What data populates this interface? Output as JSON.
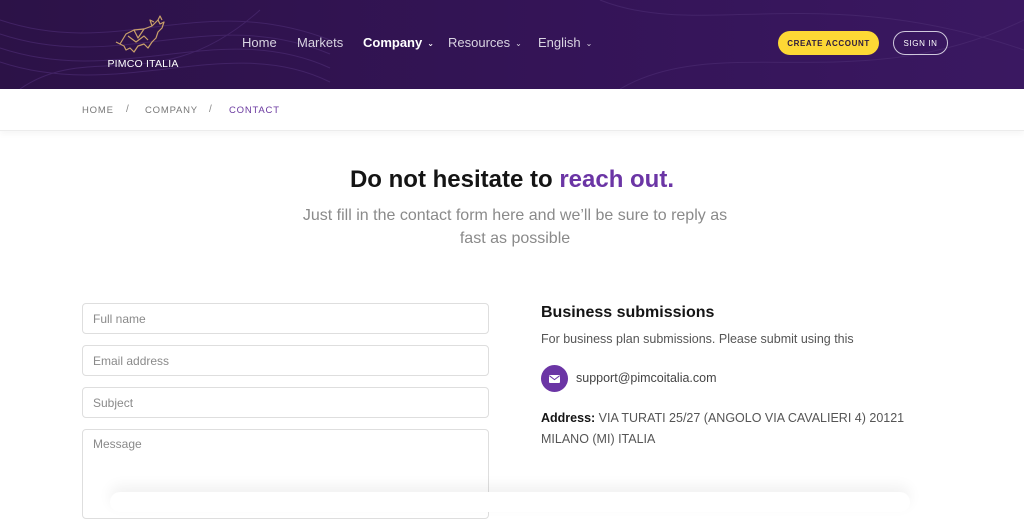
{
  "brand": {
    "name": "PIMCO ITALIA"
  },
  "nav": {
    "items": [
      {
        "label": "Home",
        "dropdown": false,
        "active": false
      },
      {
        "label": "Markets",
        "dropdown": false,
        "active": false
      },
      {
        "label": "Company",
        "dropdown": true,
        "active": true
      },
      {
        "label": "Resources",
        "dropdown": true,
        "active": false
      },
      {
        "label": "English",
        "dropdown": true,
        "active": false
      }
    ],
    "create_account": "CREATE ACCOUNT",
    "sign_in": "SIGN IN"
  },
  "breadcrumb": {
    "home": "HOME",
    "company": "COMPANY",
    "current": "CONTACT",
    "separator": "/"
  },
  "hero": {
    "title_plain": "Do not hesitate to ",
    "title_accent": "reach out.",
    "subtitle": "Just fill in the contact form here and we’ll be sure to reply as fast as possible"
  },
  "form": {
    "full_name_placeholder": "Full name",
    "email_placeholder": "Email address",
    "subject_placeholder": "Subject",
    "message_placeholder": "Message"
  },
  "business": {
    "title": "Business submissions",
    "description": "For business plan submissions. Please submit using this",
    "email": "support@pimcoitalia.com",
    "address_label": "Address:",
    "address_value": "VIA TURATI 25/27 (ANGOLO VIA CAVALIERI 4) 20121 MILANO (MI) ITALIA"
  },
  "colors": {
    "header_bg": "#341457",
    "accent": "#6b35a5",
    "cta": "#fdd835"
  },
  "icons": {
    "logo": "bull-logo-icon",
    "chevron": "chevron-down-icon",
    "mail": "envelope-icon"
  }
}
